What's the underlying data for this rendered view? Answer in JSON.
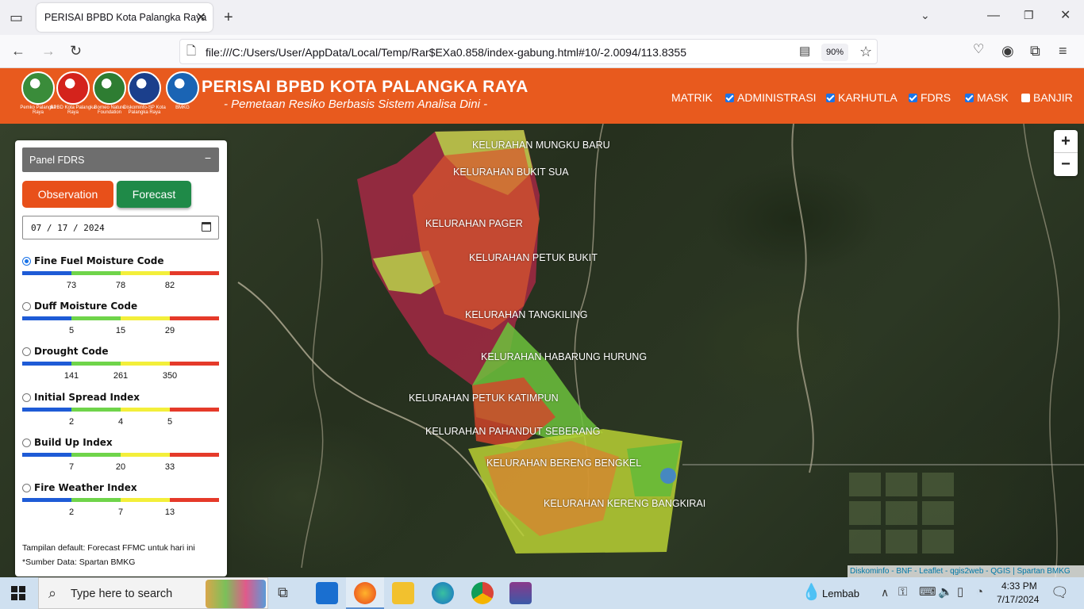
{
  "browser": {
    "tab_title": "PERISAI BPBD Kota Palangka Raya",
    "url": "file:///C:/Users/User/AppData/Local/Temp/Rar$EXa0.858/index-gabung.html#10/-2.0094/113.8355",
    "zoom": "90%"
  },
  "header": {
    "title": "PERISAI BPBD KOTA PALANGKA RAYA",
    "subtitle": "- Pemetaan Resiko Berbasis Sistem Analisa Dini -",
    "logos": [
      {
        "caption": "Pemko Palangka Raya",
        "color": "#3a8c3a"
      },
      {
        "caption": "BPBD Kota Palangka Raya",
        "color": "#d4231c"
      },
      {
        "caption": "Borneo Nature Foundation",
        "color": "#2e7d32"
      },
      {
        "caption": "Diskominfo-SP Kota Palangka Raya",
        "color": "#1b3f8c"
      },
      {
        "caption": "BMKG",
        "color": "#1a64b4"
      }
    ],
    "nav": [
      {
        "label": "MATRIK",
        "checkbox": false,
        "checked": false
      },
      {
        "label": "ADMINISTRASI",
        "checkbox": true,
        "checked": true
      },
      {
        "label": "KARHUTLA",
        "checkbox": true,
        "checked": true
      },
      {
        "label": "FDRS",
        "checkbox": true,
        "checked": true
      },
      {
        "label": "MASK",
        "checkbox": true,
        "checked": true
      },
      {
        "label": "BANJIR",
        "checkbox": true,
        "checked": false
      }
    ]
  },
  "panel": {
    "title": "Panel FDRS",
    "minimize": "−",
    "observation_label": "Observation",
    "forecast_label": "Forecast",
    "date_value": "07 / 17 / 2024",
    "scale_colors": [
      "#1e5bd6",
      "#6fd44a",
      "#f3ef3a",
      "#e53a2a"
    ],
    "indices": [
      {
        "label": "Fine Fuel Moisture Code",
        "selected": true,
        "ticks": [
          "73",
          "78",
          "82"
        ]
      },
      {
        "label": "Duff Moisture Code",
        "selected": false,
        "ticks": [
          "5",
          "15",
          "29"
        ]
      },
      {
        "label": "Drought Code",
        "selected": false,
        "ticks": [
          "141",
          "261",
          "350"
        ]
      },
      {
        "label": "Initial Spread Index",
        "selected": false,
        "ticks": [
          "2",
          "4",
          "5"
        ]
      },
      {
        "label": "Build Up Index",
        "selected": false,
        "ticks": [
          "7",
          "20",
          "33"
        ]
      },
      {
        "label": "Fire Weather Index",
        "selected": false,
        "ticks": [
          "2",
          "7",
          "13"
        ]
      }
    ],
    "note_default": "Tampilan default: Forecast FFMC untuk hari ini",
    "note_source": "*Sumber Data: Spartan BMKG"
  },
  "map": {
    "kelurahan": [
      "KELURAHAN MUNGKU BARU",
      "KELURAHAN BUKIT SUA",
      "KELURAHAN PAGER",
      "KELURAHAN PETUK BUKIT",
      "KELURAHAN TANGKILING",
      "KELURAHAN HABARUNG HURUNG",
      "KELURAHAN PETUK KATIMPUN",
      "KELURAHAN PAHANDUT SEBERANG",
      "KELURAHAN BERENG BENGKEL",
      "KELURAHAN KERENG BANGKIRAI"
    ],
    "zoom_in": "+",
    "zoom_out": "−",
    "attribution": "Diskominfo - BNF - Leaflet - qgis2web - QGIS | Spartan BMKG"
  },
  "taskbar": {
    "search_placeholder": "Type here to search",
    "weather": "Lembab",
    "time": "4:33 PM",
    "date": "7/17/2024"
  }
}
